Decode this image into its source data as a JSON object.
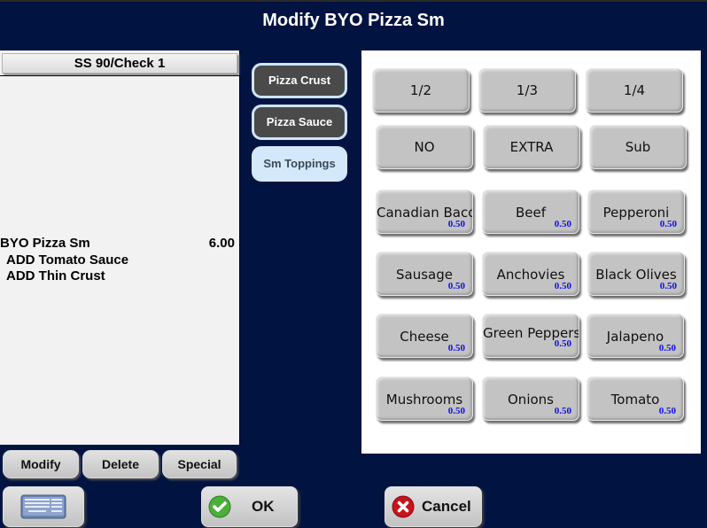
{
  "window": {
    "title": "Modify BYO Pizza Sm"
  },
  "check": {
    "header": "SS 90/Check 1",
    "lines": [
      {
        "text": "BYO Pizza Sm",
        "price": "6.00"
      },
      {
        "text": " ADD Tomato Sauce",
        "price": ""
      },
      {
        "text": " ADD Thin Crust",
        "price": ""
      }
    ]
  },
  "check_actions": {
    "modify": "Modify",
    "delete": "Delete",
    "special": "Special"
  },
  "categories": [
    {
      "label": "Pizza Crust",
      "state": "normal"
    },
    {
      "label": "Pizza Sauce",
      "state": "normal"
    },
    {
      "label": "Sm Toppings",
      "state": "selected"
    }
  ],
  "portion_buttons": [
    "1/2",
    "1/3",
    "1/4"
  ],
  "qualifier_buttons": [
    "NO",
    "EXTRA",
    "Sub"
  ],
  "toppings": [
    {
      "label": "Canadian Bacon",
      "price": "0.50"
    },
    {
      "label": "Beef",
      "price": "0.50"
    },
    {
      "label": "Pepperoni",
      "price": "0.50"
    },
    {
      "label": "Sausage",
      "price": "0.50"
    },
    {
      "label": "Anchovies",
      "price": "0.50"
    },
    {
      "label": "Black Olives",
      "price": "0.50"
    },
    {
      "label": "Cheese",
      "price": "0.50"
    },
    {
      "label": "Green Peppers",
      "price": "0.50"
    },
    {
      "label": "Jalapeno",
      "price": "0.50"
    },
    {
      "label": "Mushrooms",
      "price": "0.50"
    },
    {
      "label": "Onions",
      "price": "0.50"
    },
    {
      "label": "Tomato",
      "price": "0.50"
    }
  ],
  "footer": {
    "keyboard_icon": "keyboard-icon",
    "ok_label": "OK",
    "cancel_label": "Cancel"
  },
  "colors": {
    "background": "#011340",
    "price_text": "#1010e0",
    "ok_icon": "#4caf3a",
    "cancel_icon": "#c8141c"
  }
}
